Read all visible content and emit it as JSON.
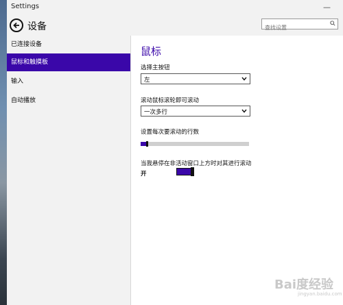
{
  "window": {
    "title": "Settings",
    "minimize_glyph": "—"
  },
  "header": {
    "page_title": "设备",
    "back_icon": "back-arrow-circle-icon"
  },
  "search": {
    "placeholder": "查找设置",
    "icon": "search-icon"
  },
  "sidebar": {
    "items": [
      {
        "label": "已连接设备",
        "active": false
      },
      {
        "label": "鼠标和触摸板",
        "active": true
      },
      {
        "label": "输入",
        "active": false
      },
      {
        "label": "自动播放",
        "active": false
      }
    ]
  },
  "main": {
    "section_title": "鼠标",
    "primary_button": {
      "label": "选择主按钮",
      "value": "左"
    },
    "scroll_wheel": {
      "label": "滚动鼠标滚轮即可滚动",
      "value": "一次多行"
    },
    "lines_to_scroll": {
      "label": "设置每次要滚动的行数",
      "value_fraction": 0.06
    },
    "inactive_scroll": {
      "label": "当我悬停在非活动窗口上方时对其进行滚动",
      "state": "开",
      "on": true
    }
  },
  "watermark": {
    "text": "Bai度经验",
    "sub": "jingyan.baidu.com"
  },
  "colors": {
    "accent": "#3a07a9",
    "chrome": "#f2f2f2",
    "text": "#111111"
  }
}
